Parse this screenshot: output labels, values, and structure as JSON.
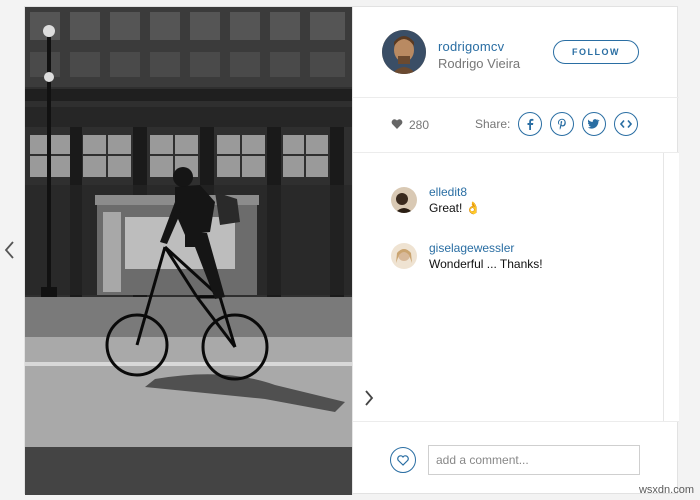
{
  "profile": {
    "username": "rodrigomcv",
    "full_name": "Rodrigo Vieira",
    "follow_label": "FOLLOW"
  },
  "stats": {
    "likes": "280",
    "share_label": "Share:",
    "share_icons": [
      "facebook-icon",
      "pinterest-icon",
      "twitter-icon",
      "embed-icon"
    ]
  },
  "comments": [
    {
      "user": "elledit8",
      "text": "Great! 👌"
    },
    {
      "user": "giselagewessler",
      "text": "Wonderful ... Thanks!"
    }
  ],
  "composer": {
    "placeholder": "add a comment..."
  },
  "watermark": "wsxdn.com",
  "colors": {
    "accent": "#2a6ea3",
    "muted_text": "#777777",
    "background": "#f3f3f3"
  }
}
